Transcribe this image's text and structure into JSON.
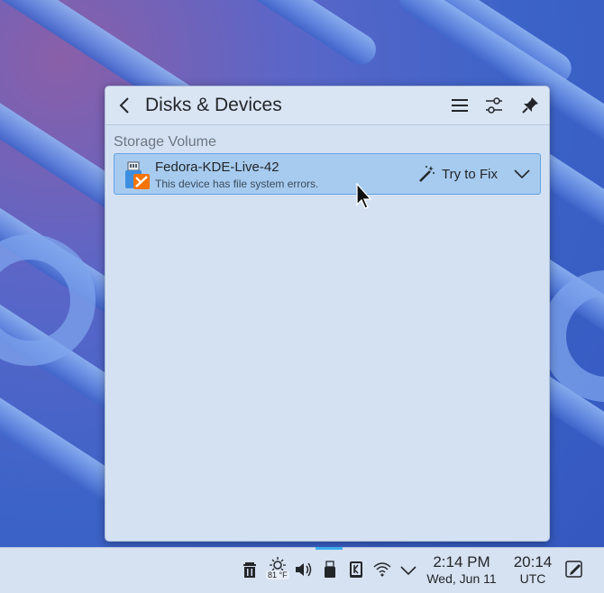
{
  "popup": {
    "title": "Disks & Devices",
    "header_buttons": [
      "back-icon",
      "menu-icon",
      "configure-icon",
      "pin-icon"
    ]
  },
  "section": {
    "title": "Storage Volume"
  },
  "device": {
    "name": "Fedora-KDE-Live-42",
    "status": "This device has file system errors.",
    "action_label": "Try to Fix",
    "icon": "usb-drive-error-icon"
  },
  "taskbar": {
    "weather_temp": "81 °F",
    "clock_time": "2:14 PM",
    "clock_date": "Wed, Jun 11",
    "utc_time": "20:14",
    "utc_label": "UTC",
    "tray_icons": [
      "trash-icon",
      "weather-icon",
      "volume-icon",
      "disks-devices-icon",
      "kde-connect-icon",
      "wifi-icon",
      "expand-tray-icon",
      "notes-icon"
    ]
  },
  "colors": {
    "accent": "#3daee9",
    "selection_bg": "#a7cbef",
    "popup_bg": "#d4e1f3",
    "error_badge": "#f67400"
  }
}
